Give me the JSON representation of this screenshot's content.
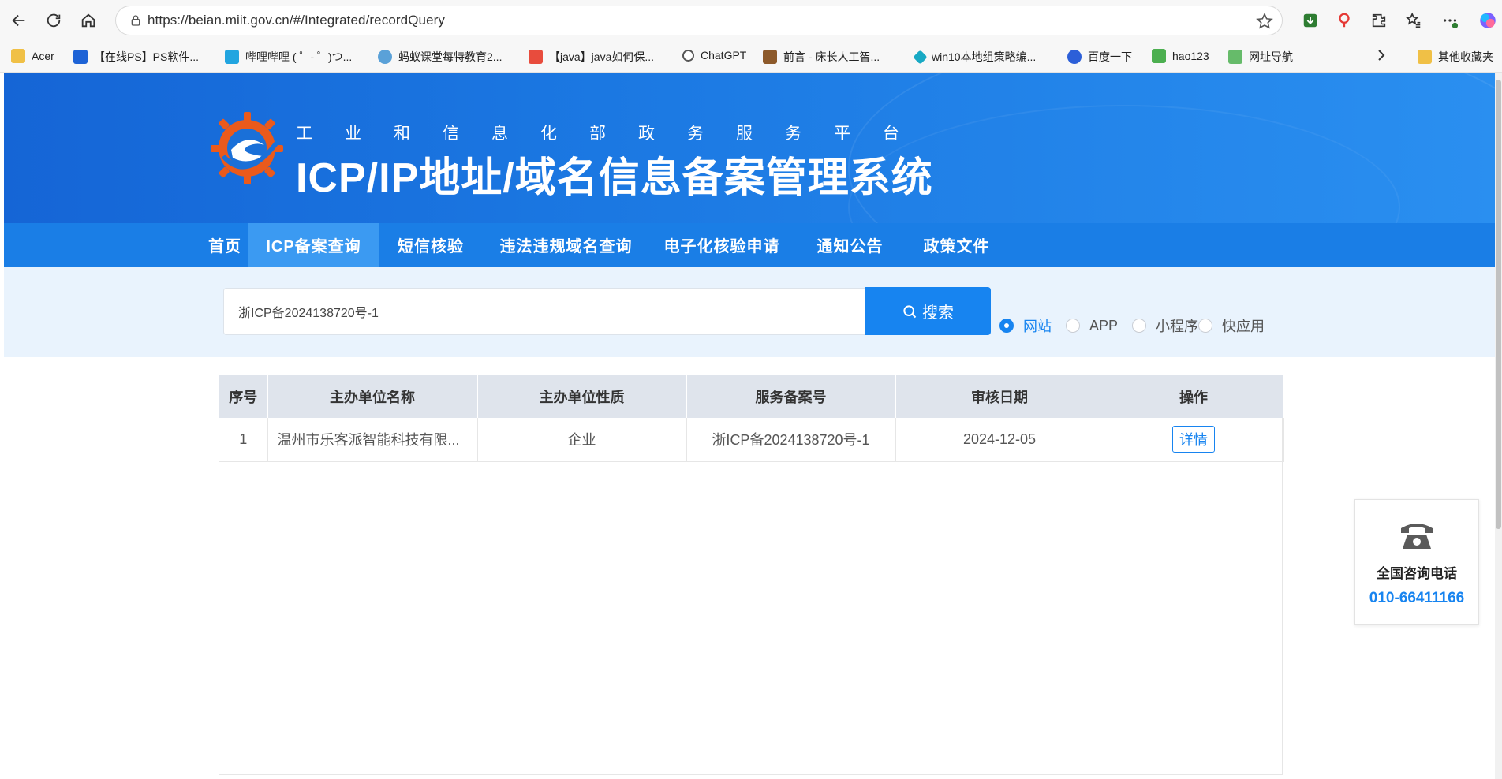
{
  "browser": {
    "url": "https://beian.miit.gov.cn/#/Integrated/recordQuery",
    "bookmarks": [
      {
        "label": "Acer",
        "icon": "folder-icon"
      },
      {
        "label": "【在线PS】PS软件...",
        "icon": "ps-icon"
      },
      {
        "label": "哔哩哔哩 ( ゜- ゜)つ...",
        "icon": "bilibili-icon"
      },
      {
        "label": "蚂蚁课堂每特教育2...",
        "icon": "ant-icon"
      },
      {
        "label": "【java】java如何保...",
        "icon": "csdn-icon"
      },
      {
        "label": "ChatGPT",
        "icon": "chatgpt-icon"
      },
      {
        "label": "前言 - 床长人工智...",
        "icon": "ai-icon"
      },
      {
        "label": "win10本地组策略编...",
        "icon": "win-icon"
      },
      {
        "label": "百度一下",
        "icon": "baidu-icon"
      },
      {
        "label": "hao123",
        "icon": "hao123-icon"
      },
      {
        "label": "网址导航",
        "icon": "nav-icon"
      },
      {
        "label": "其他收藏夹",
        "icon": "folder-icon"
      }
    ]
  },
  "header": {
    "subtitle": "工业和信息化部政务服务平台",
    "title": "ICP/IP地址/域名信息备案管理系统"
  },
  "menu": [
    {
      "label": "首页"
    },
    {
      "label": "ICP备案查询"
    },
    {
      "label": "短信核验"
    },
    {
      "label": "违法违规域名查询"
    },
    {
      "label": "电子化核验申请"
    },
    {
      "label": "通知公告"
    },
    {
      "label": "政策文件"
    }
  ],
  "search": {
    "value": "浙ICP备2024138720号-1",
    "button_label": "搜索",
    "options": [
      "网站",
      "APP",
      "小程序",
      "快应用"
    ],
    "selected": "网站"
  },
  "table": {
    "headers": [
      "序号",
      "主办单位名称",
      "主办单位性质",
      "服务备案号",
      "审核日期",
      "操作"
    ],
    "rows": [
      {
        "index": "1",
        "name": "温州市乐客派智能科技有限...",
        "type": "企业",
        "record_no": "浙ICP备2024138720号-1",
        "date": "2024-12-05",
        "action": "详情"
      }
    ]
  },
  "contact": {
    "label": "全国咨询电话",
    "phone": "010-66411166"
  },
  "colors": {
    "brand": "#1a7ee6",
    "accent": "#1784f0",
    "menu_active": "#3b9af2",
    "search_band": "#e9f3fd"
  }
}
